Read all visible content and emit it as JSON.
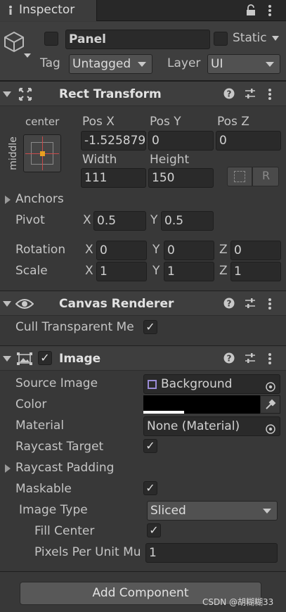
{
  "tab": {
    "title": "Inspector"
  },
  "object": {
    "name": "Panel",
    "static_label": "Static",
    "tag_label": "Tag",
    "tag_value": "Untagged",
    "layer_label": "Layer",
    "layer_value": "UI"
  },
  "rect_transform": {
    "title": "Rect Transform",
    "anchor_h": "center",
    "anchor_v": "middle",
    "pos_x_label": "Pos X",
    "pos_y_label": "Pos Y",
    "pos_z_label": "Pos Z",
    "pos_x": "-1.525879",
    "pos_y": "0",
    "pos_z": "0",
    "width_label": "Width",
    "height_label": "Height",
    "width": "111",
    "height": "150",
    "r_button": "R",
    "anchors_label": "Anchors",
    "pivot_label": "Pivot",
    "pivot_x": "0.5",
    "pivot_y": "0.5",
    "rotation_label": "Rotation",
    "rot_x": "0",
    "rot_y": "0",
    "rot_z": "0",
    "scale_label": "Scale",
    "scale_x": "1",
    "scale_y": "1",
    "scale_z": "1",
    "x": "X",
    "y": "Y",
    "z": "Z"
  },
  "canvas_renderer": {
    "title": "Canvas Renderer",
    "cull_label": "Cull Transparent Me",
    "cull_checked": true
  },
  "image": {
    "title": "Image",
    "source_label": "Source Image",
    "source_value": "Background",
    "color_label": "Color",
    "material_label": "Material",
    "material_value": "None (Material)",
    "raycast_label": "Raycast Target",
    "raycast_padding_label": "Raycast Padding",
    "maskable_label": "Maskable",
    "image_type_label": "Image Type",
    "image_type_value": "Sliced",
    "fill_center_label": "Fill Center",
    "ppu_label": "Pixels Per Unit Mu",
    "ppu_value": "1"
  },
  "footer": {
    "add_component": "Add Component",
    "watermark": "CSDN @胡糊糊33"
  },
  "icons": [
    "inspector-icon",
    "lock-icon",
    "more-icon",
    "cube-icon",
    "move-icon",
    "help-icon",
    "preset-icon",
    "eye-icon",
    "image-icon",
    "object-picker-icon",
    "eyedropper-icon",
    "blueprint-icon"
  ]
}
